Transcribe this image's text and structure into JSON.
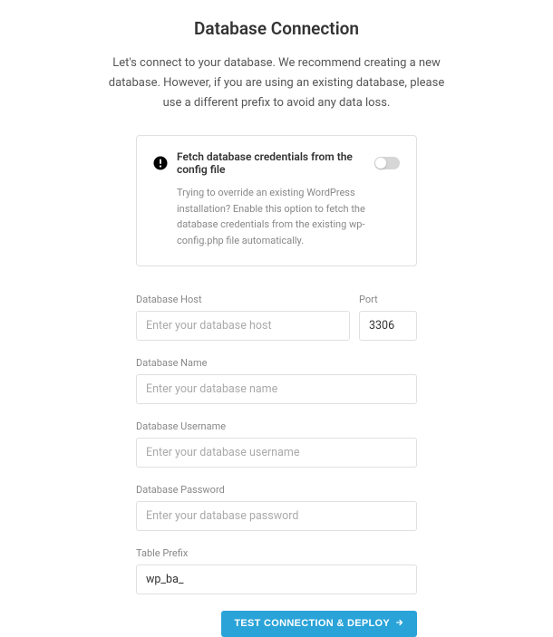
{
  "title": "Database Connection",
  "subtitle": "Let's connect to your database. We recommend creating a new database. However, if you are using an existing database, please use a different prefix to avoid any data loss.",
  "info_box": {
    "title": "Fetch database credentials from the config file",
    "description": "Trying to override an existing WordPress installation? Enable this option to fetch the database credentials from the existing wp-config.php file automatically.",
    "toggle_on": false
  },
  "fields": {
    "host": {
      "label": "Database Host",
      "placeholder": "Enter your database host",
      "value": ""
    },
    "port": {
      "label": "Port",
      "placeholder": "",
      "value": "3306"
    },
    "name": {
      "label": "Database Name",
      "placeholder": "Enter your database name",
      "value": ""
    },
    "username": {
      "label": "Database Username",
      "placeholder": "Enter your database username",
      "value": ""
    },
    "password": {
      "label": "Database Password",
      "placeholder": "Enter your database password",
      "value": ""
    },
    "prefix": {
      "label": "Table Prefix",
      "placeholder": "",
      "value": "wp_ba_"
    }
  },
  "submit_label": "TEST CONNECTION & DEPLOY",
  "colors": {
    "primary": "#2aa3d8"
  }
}
